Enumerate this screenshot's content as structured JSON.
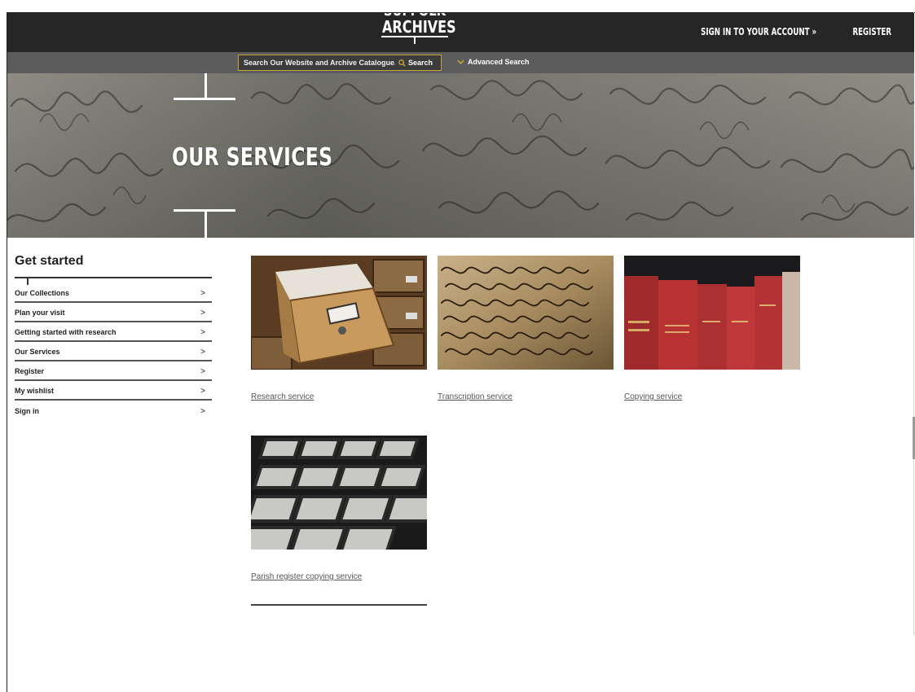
{
  "header": {
    "logo_top": "SUFFOLK",
    "logo_main": "ARCHIVES",
    "sign_in": "SIGN IN TO YOUR ACCOUNT »",
    "register": "REGISTER"
  },
  "search": {
    "placeholder": "Search Our Website and Archive Catalogue...",
    "button_label": "Search",
    "advanced_label": "Advanced Search"
  },
  "hero": {
    "title": "OUR SERVICES"
  },
  "sidebar": {
    "title": "Get started",
    "items": [
      {
        "label": "Our Collections"
      },
      {
        "label": "Plan your visit"
      },
      {
        "label": "Getting started with research"
      },
      {
        "label": "Our Services"
      },
      {
        "label": "Register"
      },
      {
        "label": "My wishlist"
      },
      {
        "label": "Sign in"
      }
    ],
    "chevron": ">"
  },
  "services": [
    {
      "label": "Research service",
      "icon": "card-catalogue-drawer-photo"
    },
    {
      "label": "Transcription service",
      "icon": "handwritten-document-photo"
    },
    {
      "label": "Copying service",
      "icon": "red-bound-directories-photo"
    },
    {
      "label": "Parish register copying service",
      "icon": "microfiche-slides-photo"
    }
  ],
  "colors": {
    "header_bg": "#262626",
    "searchbar_bg": "#5c5c5c",
    "accent_gold": "#c9a23c",
    "text_dark": "#222222"
  }
}
